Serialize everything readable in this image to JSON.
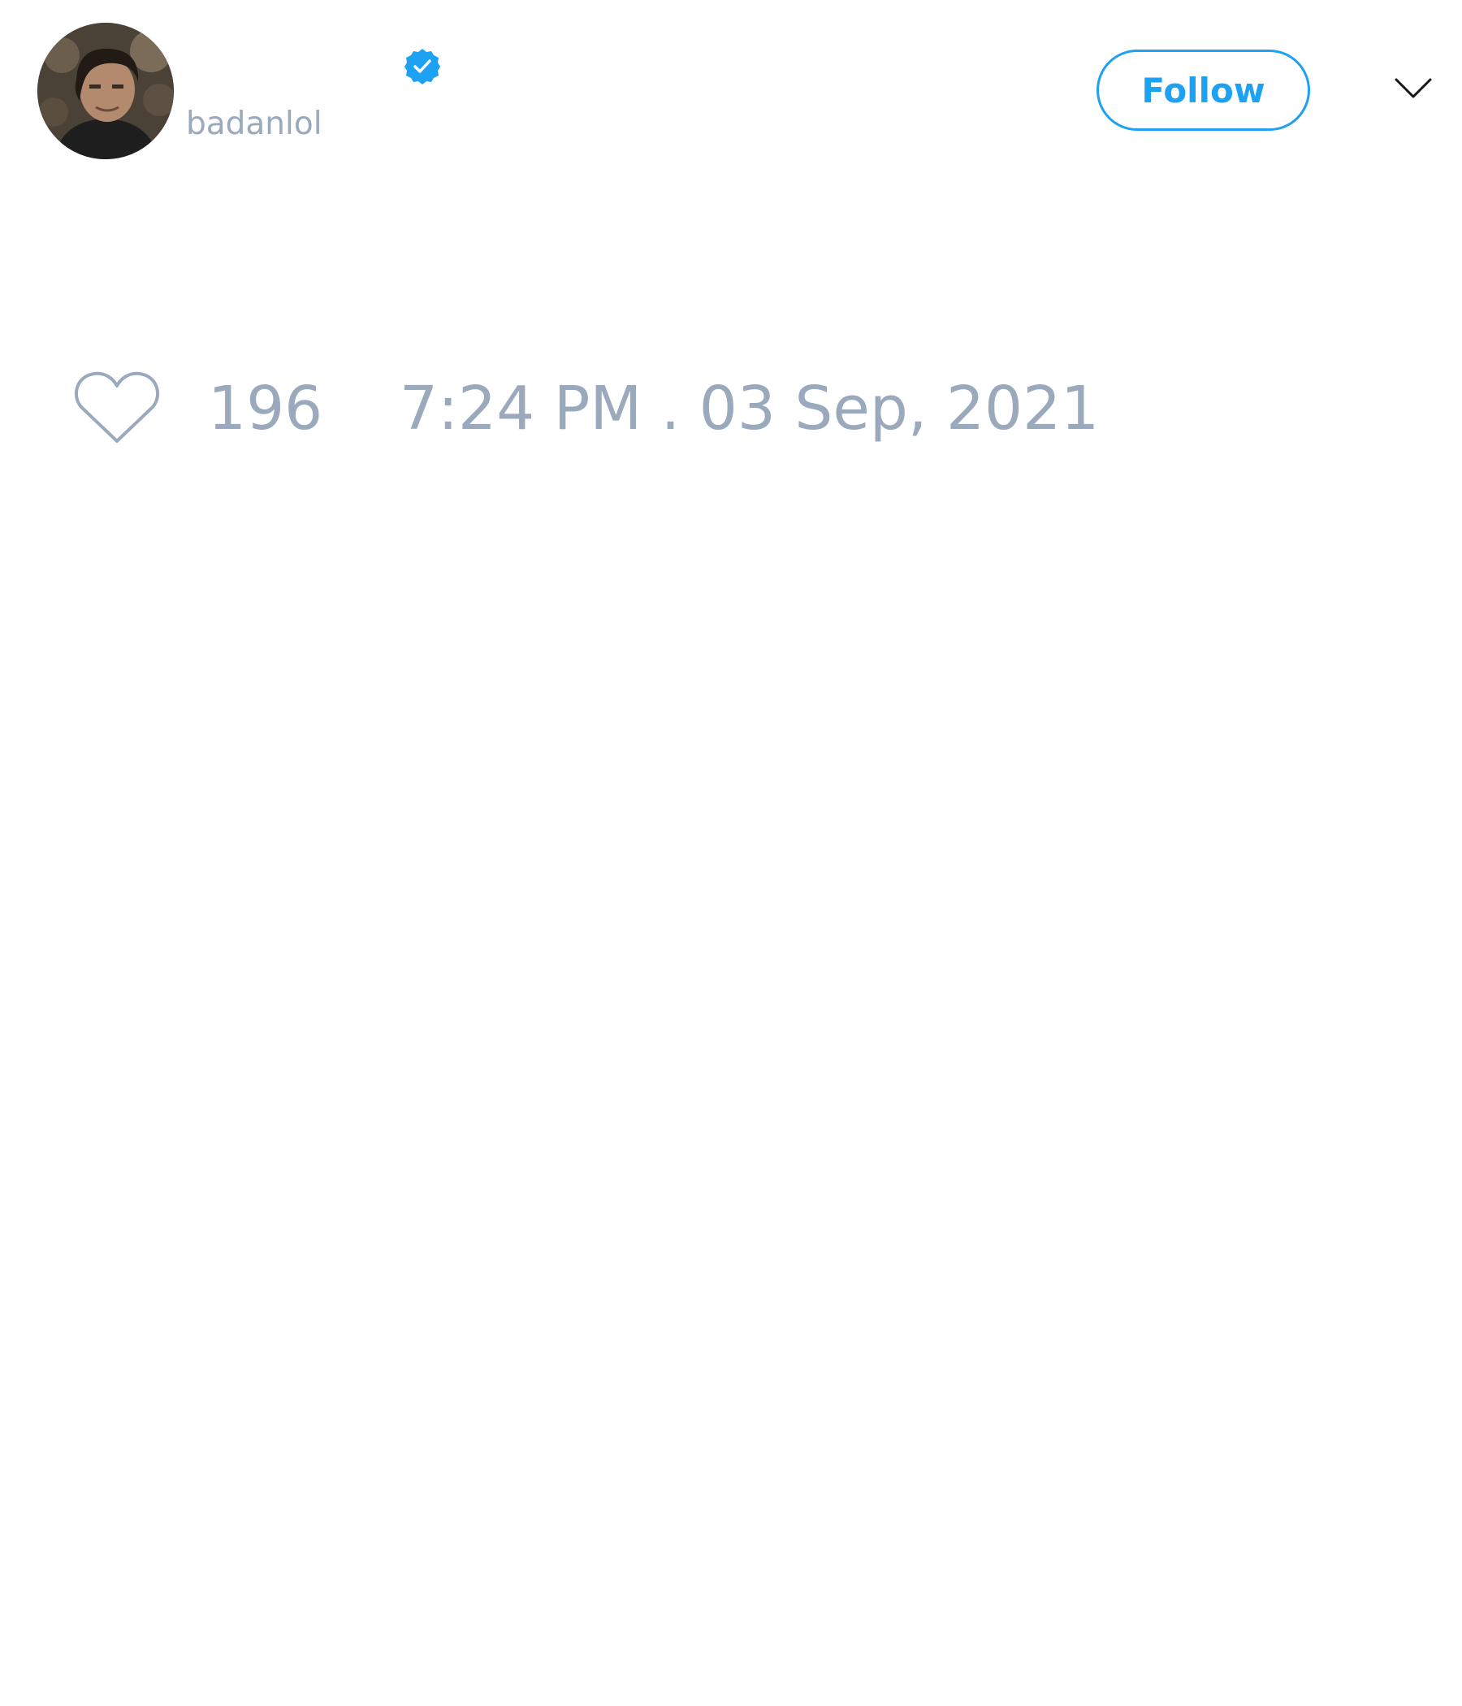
{
  "tweet": {
    "author": {
      "handle": "badanlol",
      "verified": true,
      "avatar_icon": "user-avatar-photo"
    },
    "follow_button_label": "Follow",
    "menu_icon": "chevron-down-icon",
    "likes": "196",
    "timestamp": "7:24 PM . 03 Sep, 2021"
  },
  "colors": {
    "accent": "#1da1f2",
    "muted_text": "#9aa9bc",
    "background": "#ffffff"
  }
}
